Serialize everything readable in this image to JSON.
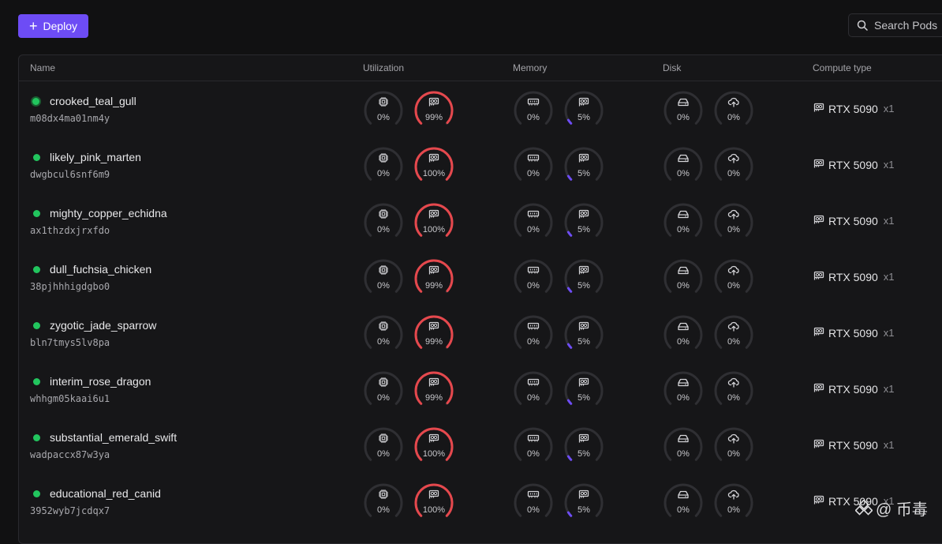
{
  "toolbar": {
    "deploy_label": "Deploy",
    "search_placeholder": "Search Pods"
  },
  "table": {
    "columns": [
      "Name",
      "Utilization",
      "Memory",
      "Disk",
      "Compute type"
    ],
    "rows": [
      {
        "name": "crooked_teal_gull",
        "id": "m08dx4ma01nm4y",
        "status": "selected",
        "cpu": 0,
        "gpu": 99,
        "ram": 0,
        "vram": 5,
        "disk": 0,
        "volume": 0,
        "gpu_model": "RTX 5090",
        "gpu_count": "x1"
      },
      {
        "name": "likely_pink_marten",
        "id": "dwgbcul6snf6m9",
        "status": "running",
        "cpu": 0,
        "gpu": 100,
        "ram": 0,
        "vram": 5,
        "disk": 0,
        "volume": 0,
        "gpu_model": "RTX 5090",
        "gpu_count": "x1"
      },
      {
        "name": "mighty_copper_echidna",
        "id": "ax1thzdxjrxfdo",
        "status": "running",
        "cpu": 0,
        "gpu": 100,
        "ram": 0,
        "vram": 5,
        "disk": 0,
        "volume": 0,
        "gpu_model": "RTX 5090",
        "gpu_count": "x1"
      },
      {
        "name": "dull_fuchsia_chicken",
        "id": "38pjhhhigdgbo0",
        "status": "running",
        "cpu": 0,
        "gpu": 99,
        "ram": 0,
        "vram": 5,
        "disk": 0,
        "volume": 0,
        "gpu_model": "RTX 5090",
        "gpu_count": "x1"
      },
      {
        "name": "zygotic_jade_sparrow",
        "id": "bln7tmys5lv8pa",
        "status": "running",
        "cpu": 0,
        "gpu": 99,
        "ram": 0,
        "vram": 5,
        "disk": 0,
        "volume": 0,
        "gpu_model": "RTX 5090",
        "gpu_count": "x1"
      },
      {
        "name": "interim_rose_dragon",
        "id": "whhgm05kaai6u1",
        "status": "running",
        "cpu": 0,
        "gpu": 99,
        "ram": 0,
        "vram": 5,
        "disk": 0,
        "volume": 0,
        "gpu_model": "RTX 5090",
        "gpu_count": "x1"
      },
      {
        "name": "substantial_emerald_swift",
        "id": "wadpaccx87w3ya",
        "status": "running",
        "cpu": 0,
        "gpu": 100,
        "ram": 0,
        "vram": 5,
        "disk": 0,
        "volume": 0,
        "gpu_model": "RTX 5090",
        "gpu_count": "x1"
      },
      {
        "name": "educational_red_canid",
        "id": "3952wyb7jcdqx7",
        "status": "running",
        "cpu": 0,
        "gpu": 100,
        "ram": 0,
        "vram": 5,
        "disk": 0,
        "volume": 0,
        "gpu_model": "RTX 5090",
        "gpu_count": "x1"
      }
    ]
  },
  "gauge_icons": {
    "cpu": "cpu-chip-icon",
    "gpu": "gpu-card-icon",
    "ram": "memory-stick-icon",
    "vram": "gpu-card-icon",
    "disk": "hard-drive-icon",
    "volume": "cloud-upload-icon"
  },
  "colors": {
    "accent": "#6d4cf5",
    "gauge_track": "#2f2f33",
    "gpu_gauge": "#e5484d",
    "vram_gauge": "#6d4cf5",
    "running_status": "#22c55e"
  },
  "watermark": {
    "text": "@ 币毒"
  }
}
